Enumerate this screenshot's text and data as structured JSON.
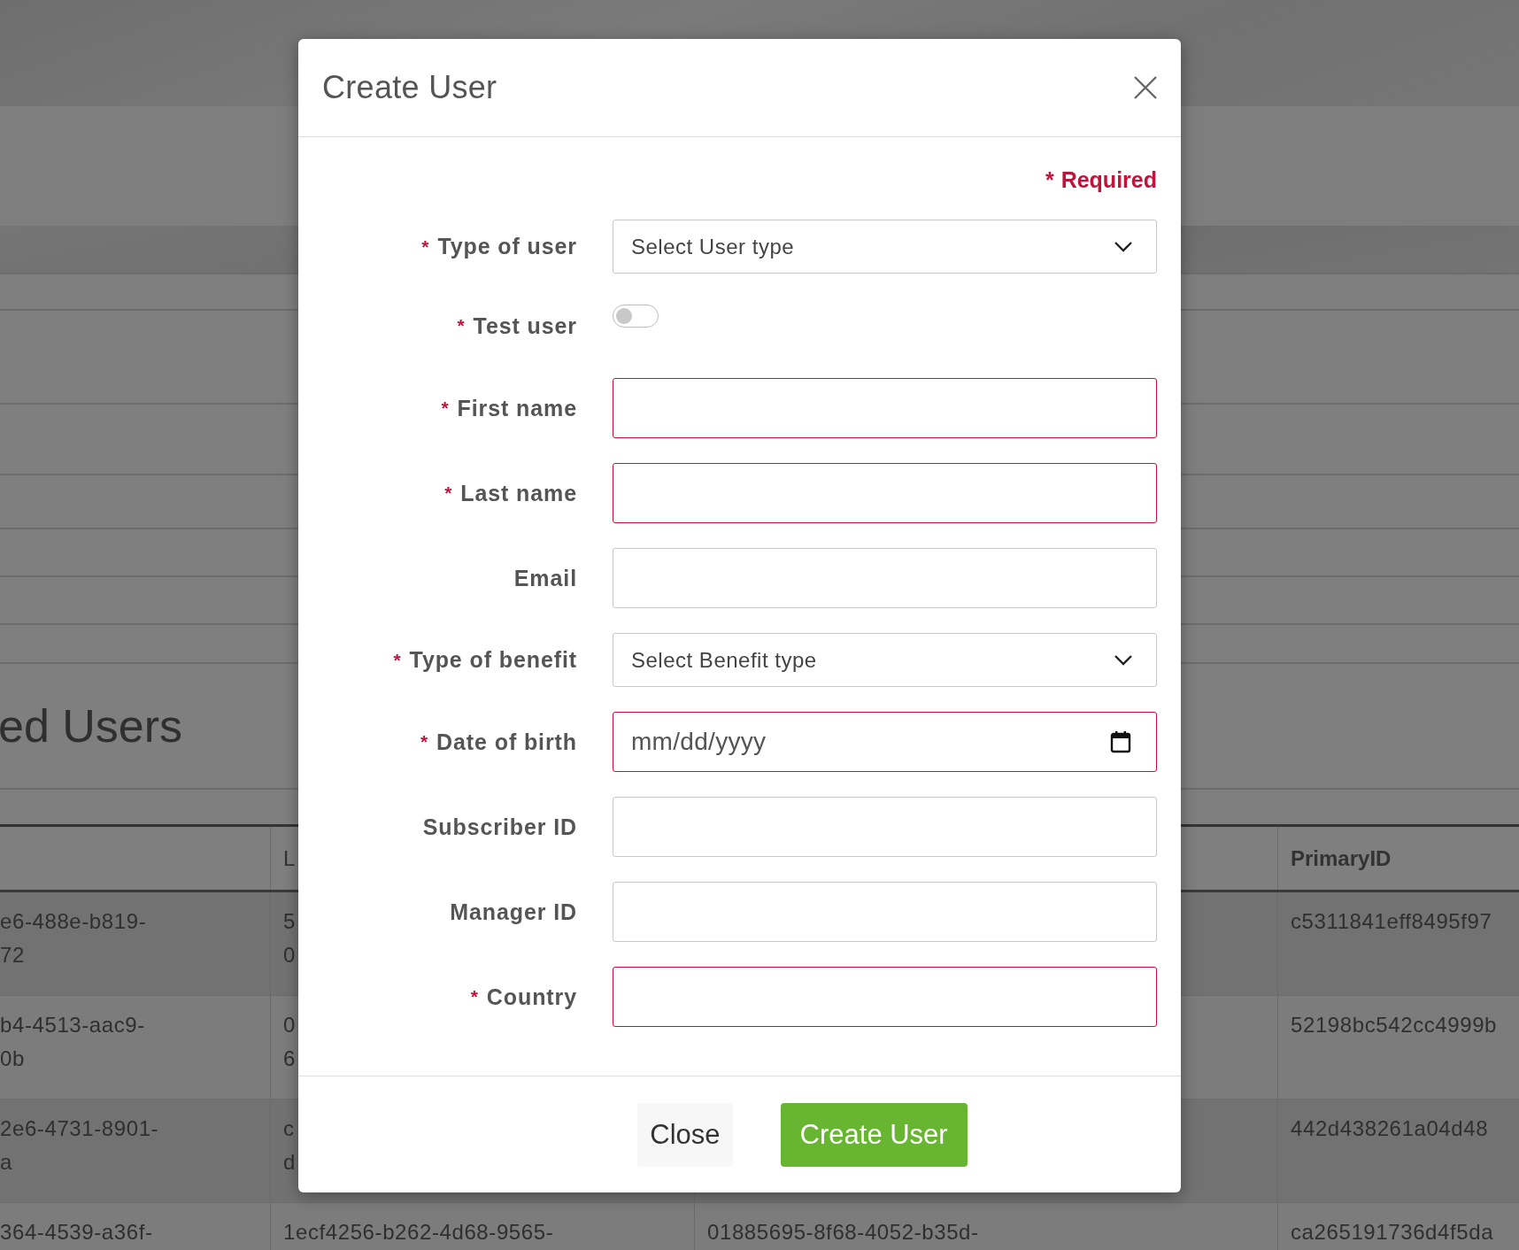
{
  "background": {
    "heading": "ed Users",
    "table": {
      "header": {
        "column_2": "L",
        "column_4": "PrimaryID"
      },
      "rows": [
        {
          "column_1": "e6-488e-b819-\n72",
          "column_2": "5\n0",
          "column_4": "c5311841eff8495f97"
        },
        {
          "column_1": "b4-4513-aac9-\n0b",
          "column_2": "0\n6",
          "column_4": "52198bc542cc4999b"
        },
        {
          "column_1": "2e6-4731-8901-\na",
          "column_2": "c\nd",
          "column_4": "442d438261a04d48"
        },
        {
          "column_1": "364-4539-a36f-",
          "column_2": "1ecf4256-b262-4d68-9565-",
          "column_3": "01885695-8f68-4052-b35d-",
          "column_4": "ca265191736d4f5da"
        }
      ]
    }
  },
  "modal": {
    "title": "Create User",
    "required_note": {
      "mark": "*",
      "text": "Required"
    },
    "fields": [
      {
        "kind": "select",
        "label": "Type of user",
        "mark": "*",
        "placeholder": "Select User type",
        "invalid": false
      },
      {
        "kind": "toggle",
        "label": "Test user",
        "mark": "*",
        "on": false
      },
      {
        "kind": "text",
        "label": "First name",
        "mark": "*",
        "invalid": true
      },
      {
        "kind": "text",
        "label": "Last name",
        "mark": "*",
        "invalid": true
      },
      {
        "kind": "text",
        "label": "Email",
        "invalid": false
      },
      {
        "kind": "select",
        "label": "Type of benefit",
        "mark": "*",
        "placeholder": "Select Benefit type",
        "invalid": false
      },
      {
        "kind": "date",
        "label": "Date of birth",
        "mark": "*",
        "placeholder": "mm/dd/yyyy",
        "invalid": true
      },
      {
        "kind": "text",
        "label": "Subscriber ID",
        "invalid": false
      },
      {
        "kind": "text",
        "label": "Manager ID",
        "invalid": false
      },
      {
        "kind": "text",
        "label": "Country",
        "mark": "*",
        "invalid": true
      }
    ],
    "buttons": [
      {
        "kind": "secondary",
        "label": "Close"
      },
      {
        "kind": "primary",
        "label": "Create User"
      }
    ]
  }
}
